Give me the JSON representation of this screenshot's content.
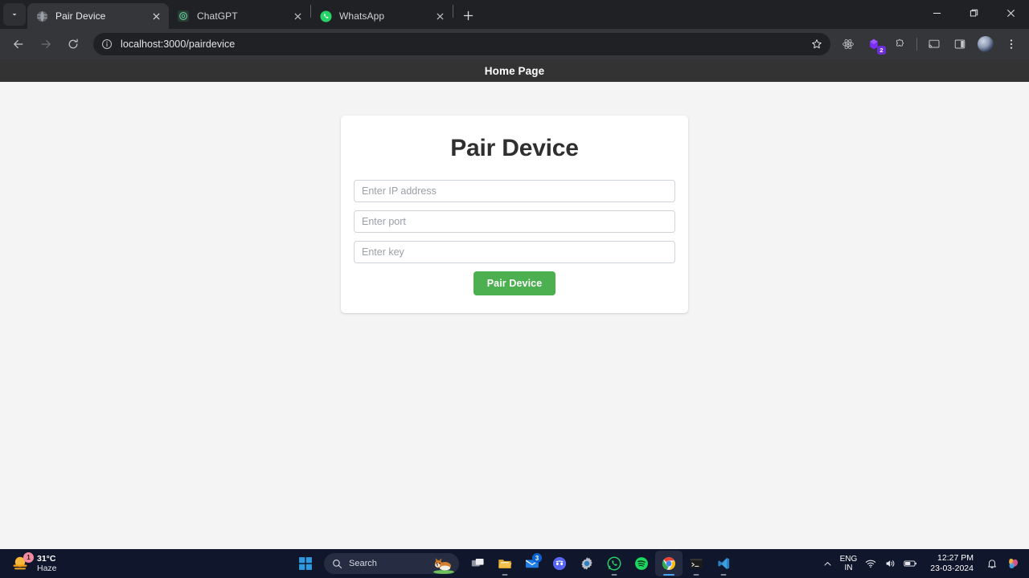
{
  "browser": {
    "tablist_button": "tab-search",
    "tabs": [
      {
        "title": "Pair Device",
        "favicon": "globe-icon",
        "active": true,
        "close": "×"
      },
      {
        "title": "ChatGPT",
        "favicon": "chatgpt-icon",
        "active": false,
        "close": "×"
      },
      {
        "title": "WhatsApp",
        "favicon": "whatsapp-icon",
        "active": false,
        "close": "×"
      }
    ],
    "new_tab_label": "+",
    "window_controls": {
      "minimize": "—",
      "maximize": "▢",
      "close": "×"
    },
    "nav": {
      "back": "back-arrow-icon",
      "forward": "forward-arrow-icon",
      "reload": "reload-icon"
    },
    "omnibox": {
      "url": "localhost:3000/pairdevice",
      "site_info_icon": "info-circle-icon",
      "bookmark_icon": "star-icon"
    },
    "toolbar_icons": [
      {
        "name": "react-devtools-icon",
        "badge": null
      },
      {
        "name": "extension-purple-icon",
        "badge": "2"
      },
      {
        "name": "extensions-puzzle-icon",
        "badge": null
      },
      {
        "name": "cast-icon",
        "badge": null
      },
      {
        "name": "side-panel-icon",
        "badge": null
      },
      {
        "name": "profile-avatar",
        "badge": null
      },
      {
        "name": "chrome-menu-icon",
        "badge": null
      }
    ]
  },
  "page": {
    "header_title": "Home Page",
    "card_title": "Pair Device",
    "fields": [
      {
        "name": "ip-address",
        "placeholder": "Enter IP address",
        "value": ""
      },
      {
        "name": "port",
        "placeholder": "Enter port",
        "value": ""
      },
      {
        "name": "key",
        "placeholder": "Enter key",
        "value": ""
      }
    ],
    "submit_label": "Pair Device",
    "accent_color": "#4caf50",
    "header_bg": "#333333",
    "page_bg": "#f4f4f4"
  },
  "taskbar": {
    "weather": {
      "temperature": "31°C",
      "condition": "Haze",
      "badge": "1",
      "icon": "sun-haze-icon"
    },
    "start_icon": "windows-start-icon",
    "search": {
      "placeholder": "Search",
      "icon": "search-icon",
      "decoration": "corgi-dog-image"
    },
    "apps": [
      {
        "name": "task-view-icon",
        "running": false,
        "badge": null
      },
      {
        "name": "file-explorer-icon",
        "running": true,
        "badge": null
      },
      {
        "name": "mail-icon",
        "running": false,
        "badge": "3"
      },
      {
        "name": "discord-icon",
        "running": false,
        "badge": null
      },
      {
        "name": "settings-gear-icon",
        "running": false,
        "badge": null
      },
      {
        "name": "whatsapp-icon",
        "running": true,
        "badge": null
      },
      {
        "name": "spotify-icon",
        "running": false,
        "badge": null
      },
      {
        "name": "chrome-icon",
        "running": true,
        "badge": null
      },
      {
        "name": "terminal-icon",
        "running": true,
        "badge": null
      },
      {
        "name": "vscode-icon",
        "running": true,
        "badge": null
      }
    ],
    "tray": {
      "chevron": "show-hidden-icons",
      "language_top": "ENG",
      "language_bottom": "IN",
      "wifi_icon": "wifi-icon",
      "volume_icon": "volume-icon",
      "battery_icon": "battery-icon",
      "time": "12:27 PM",
      "date": "23-03-2024",
      "notifications_icon": "notification-bell-icon",
      "copilot_icon": "copilot-icon"
    }
  }
}
